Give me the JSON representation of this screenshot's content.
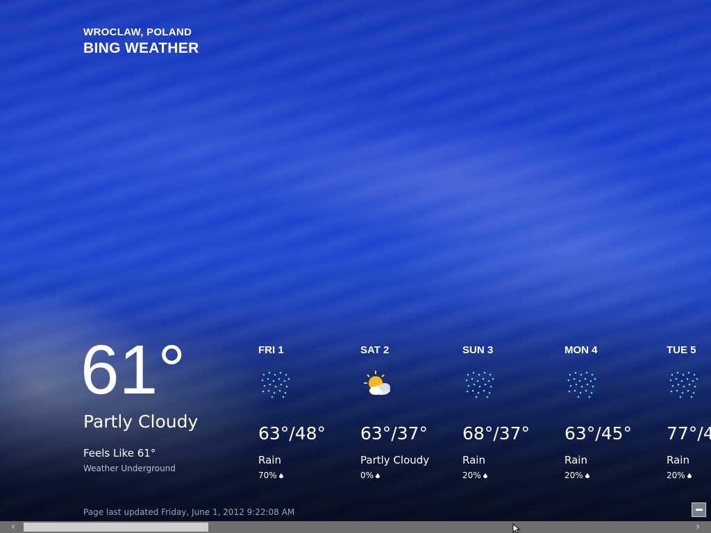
{
  "header": {
    "location": "WROCLAW, POLAND",
    "app_title": "BING WEATHER"
  },
  "current": {
    "temperature": "61°",
    "condition": "Partly Cloudy",
    "feels_like": "Feels Like 61°",
    "provider": "Weather Underground"
  },
  "forecast": [
    {
      "day": "FRI 1",
      "icon": "rain-icon",
      "temps": "63°/48°",
      "condition": "Rain",
      "precip": "70%"
    },
    {
      "day": "SAT 2",
      "icon": "partly-cloudy-icon",
      "temps": "63°/37°",
      "condition": "Partly Cloudy",
      "precip": "0%"
    },
    {
      "day": "SUN 3",
      "icon": "rain-icon",
      "temps": "68°/37°",
      "condition": "Rain",
      "precip": "20%"
    },
    {
      "day": "MON 4",
      "icon": "rain-icon",
      "temps": "63°/45°",
      "condition": "Rain",
      "precip": "20%"
    },
    {
      "day": "TUE 5",
      "icon": "rain-icon",
      "temps": "77°/4",
      "condition": "Rain",
      "precip": "20%"
    }
  ],
  "footer": {
    "last_updated": "Page last updated Friday, June 1, 2012 9:22:08 AM"
  },
  "scrollbar": {
    "left_arrow": "‹",
    "right_arrow": "›"
  },
  "colors": {
    "sky_top": "#1536b8",
    "sky_mid": "#1d45cf",
    "sky_bottom": "#070f26",
    "scrollbar_track": "#6e6e6e",
    "scrollbar_thumb": "#cfcfcf"
  }
}
